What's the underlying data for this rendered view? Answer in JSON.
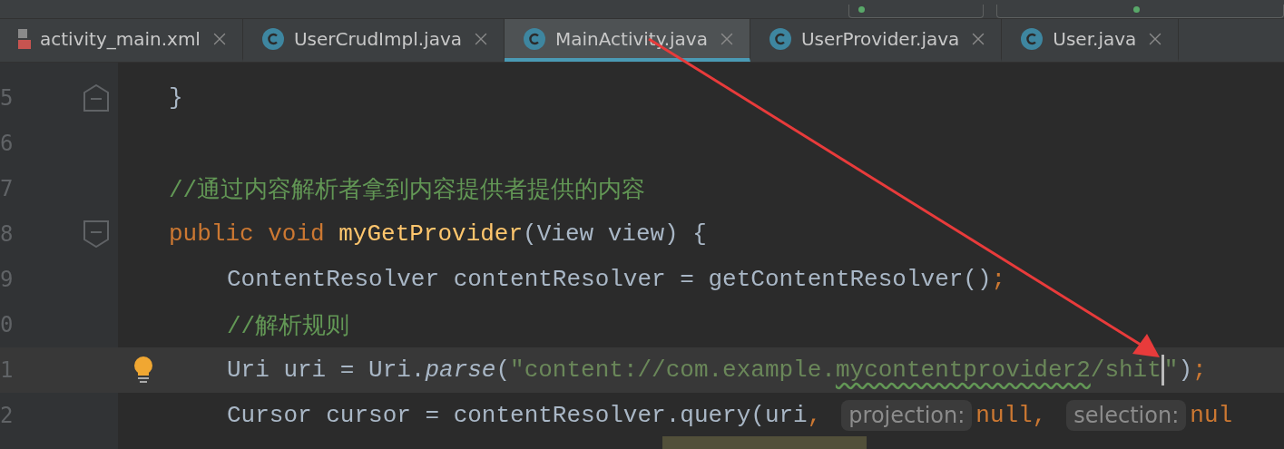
{
  "tabs": [
    {
      "label": "activity_main.xml",
      "kind": "xml",
      "selected": false
    },
    {
      "label": "UserCrudImpl.java",
      "kind": "class",
      "selected": false
    },
    {
      "label": "MainActivity.java",
      "kind": "class",
      "selected": true
    },
    {
      "label": "UserProvider.java",
      "kind": "class",
      "selected": false
    },
    {
      "label": "User.java",
      "kind": "class",
      "selected": false
    }
  ],
  "editor": {
    "lines": [
      {
        "number": "5",
        "fold_end": true,
        "current": false,
        "bulb": false,
        "tokens": [
          {
            "kind": "plain",
            "text": "}"
          }
        ]
      },
      {
        "number": "6",
        "current": false,
        "bulb": false
      },
      {
        "number": "7",
        "current": false,
        "bulb": false,
        "tokens": [
          {
            "kind": "comment",
            "text": "//通过内容解析者拿到内容提供者提供的内容"
          }
        ]
      },
      {
        "number": "8",
        "fold_start": true,
        "current": false,
        "bulb": false,
        "tokens": [
          {
            "kind": "keyword",
            "text": "public void "
          },
          {
            "kind": "method",
            "text": "myGetProvider"
          },
          {
            "kind": "plain",
            "text": "(View view) {"
          }
        ],
        "children": [
          {
            "number": "9",
            "current": false,
            "bulb": false,
            "tokens": [
              {
                "kind": "plain",
                "text": "ContentResolver contentResolver = getContentResolver()"
              },
              {
                "kind": "keyword",
                "text": ";"
              }
            ]
          },
          {
            "number": "0",
            "current": false,
            "bulb": false,
            "tokens": [
              {
                "kind": "comment",
                "text": "//解析规则"
              }
            ]
          },
          {
            "number": "1",
            "current": true,
            "bulb": true,
            "tokens": [
              {
                "kind": "plain",
                "text": "Uri uri = Uri."
              },
              {
                "kind": "italic",
                "text": "parse"
              },
              {
                "kind": "plain",
                "text": "("
              },
              {
                "kind": "string",
                "text": "\"content://com.example."
              },
              {
                "kind": "string",
                "text": "mycontentprovider2",
                "squiggle": true
              },
              {
                "kind": "string",
                "text": "/shit"
              },
              {
                "kind": "caret"
              },
              {
                "kind": "string",
                "text": "\""
              },
              {
                "kind": "plain",
                "text": ")"
              },
              {
                "kind": "keyword",
                "text": ";"
              }
            ]
          },
          {
            "number": "2",
            "current": false,
            "bulb": false,
            "tokens": [
              {
                "kind": "plain",
                "text": "Cursor cursor = contentResolver.query(uri"
              },
              {
                "kind": "keyword",
                "text": ","
              },
              {
                "kind": "hint",
                "text": "projection:"
              },
              {
                "kind": "keyword",
                "text": "null"
              },
              {
                "kind": "keyword",
                "text": ","
              },
              {
                "kind": "hint",
                "text": "selection:"
              },
              {
                "kind": "keyword",
                "text": "nul"
              }
            ]
          }
        ]
      }
    ]
  }
}
